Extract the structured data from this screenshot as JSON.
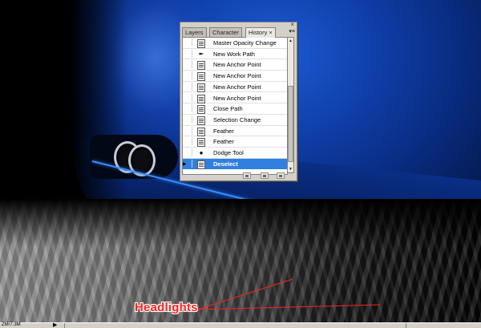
{
  "history_panel": {
    "tabs": [
      {
        "label": "Layers"
      },
      {
        "label": "Character"
      },
      {
        "label": "History"
      }
    ],
    "tab_close_glyph": "×",
    "window_close_glyph": "×",
    "menu_glyph": "▾≡",
    "items": [
      {
        "label": "Master Opacity Change",
        "icon": "snapshot-icon"
      },
      {
        "label": "New Work Path",
        "icon": "pen-tool-icon"
      },
      {
        "label": "New Anchor Point",
        "icon": "snapshot-icon"
      },
      {
        "label": "New Anchor Point",
        "icon": "snapshot-icon"
      },
      {
        "label": "New Anchor Point",
        "icon": "snapshot-icon"
      },
      {
        "label": "New Anchor Point",
        "icon": "snapshot-icon"
      },
      {
        "label": "Close Path",
        "icon": "snapshot-icon"
      },
      {
        "label": "Selection Change",
        "icon": "snapshot-icon"
      },
      {
        "label": "Feather",
        "icon": "snapshot-icon"
      },
      {
        "label": "Feather",
        "icon": "snapshot-icon"
      },
      {
        "label": "Dodge Tool",
        "icon": "dodge-tool-icon"
      },
      {
        "label": "Deselect",
        "icon": "snapshot-icon",
        "selected": true
      }
    ]
  },
  "annotation": {
    "label": "Headlights",
    "color": "#ff2020"
  },
  "statusbar": {
    "zoom": "ZM/7.3M",
    "arrow": "▶"
  },
  "colors": {
    "selection": "#2f7fe0",
    "panel_bg": "#d4d0c8",
    "car_blue": "#0f3ea8"
  }
}
